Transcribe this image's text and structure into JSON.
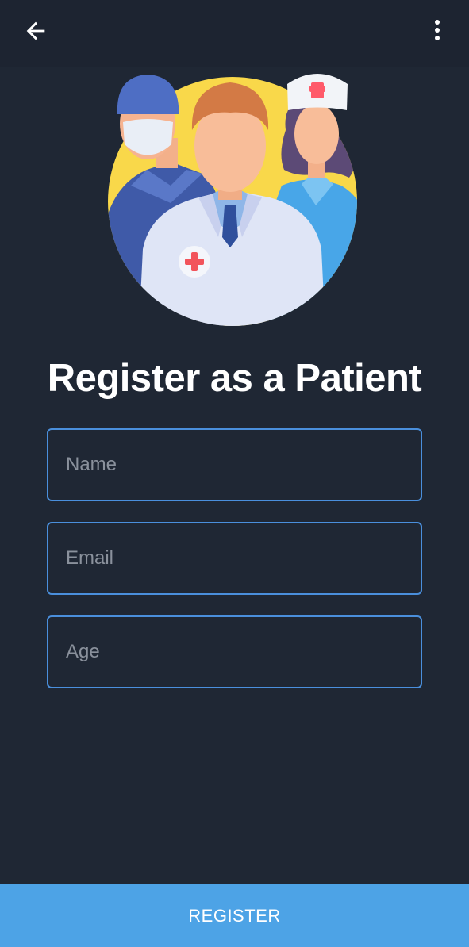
{
  "app_bar": {
    "back_icon": "arrow-left-icon",
    "menu_icon": "more-vertical-icon"
  },
  "hero": {
    "illustration": "medical-staff-illustration"
  },
  "title": "Register as a Patient",
  "form": {
    "name_placeholder": "Name",
    "email_placeholder": "Email",
    "age_placeholder": "Age"
  },
  "register_label": "REGISTER",
  "colors": {
    "background": "#1f2734",
    "field_border": "#4a8fdc",
    "button": "#4da3e6"
  }
}
